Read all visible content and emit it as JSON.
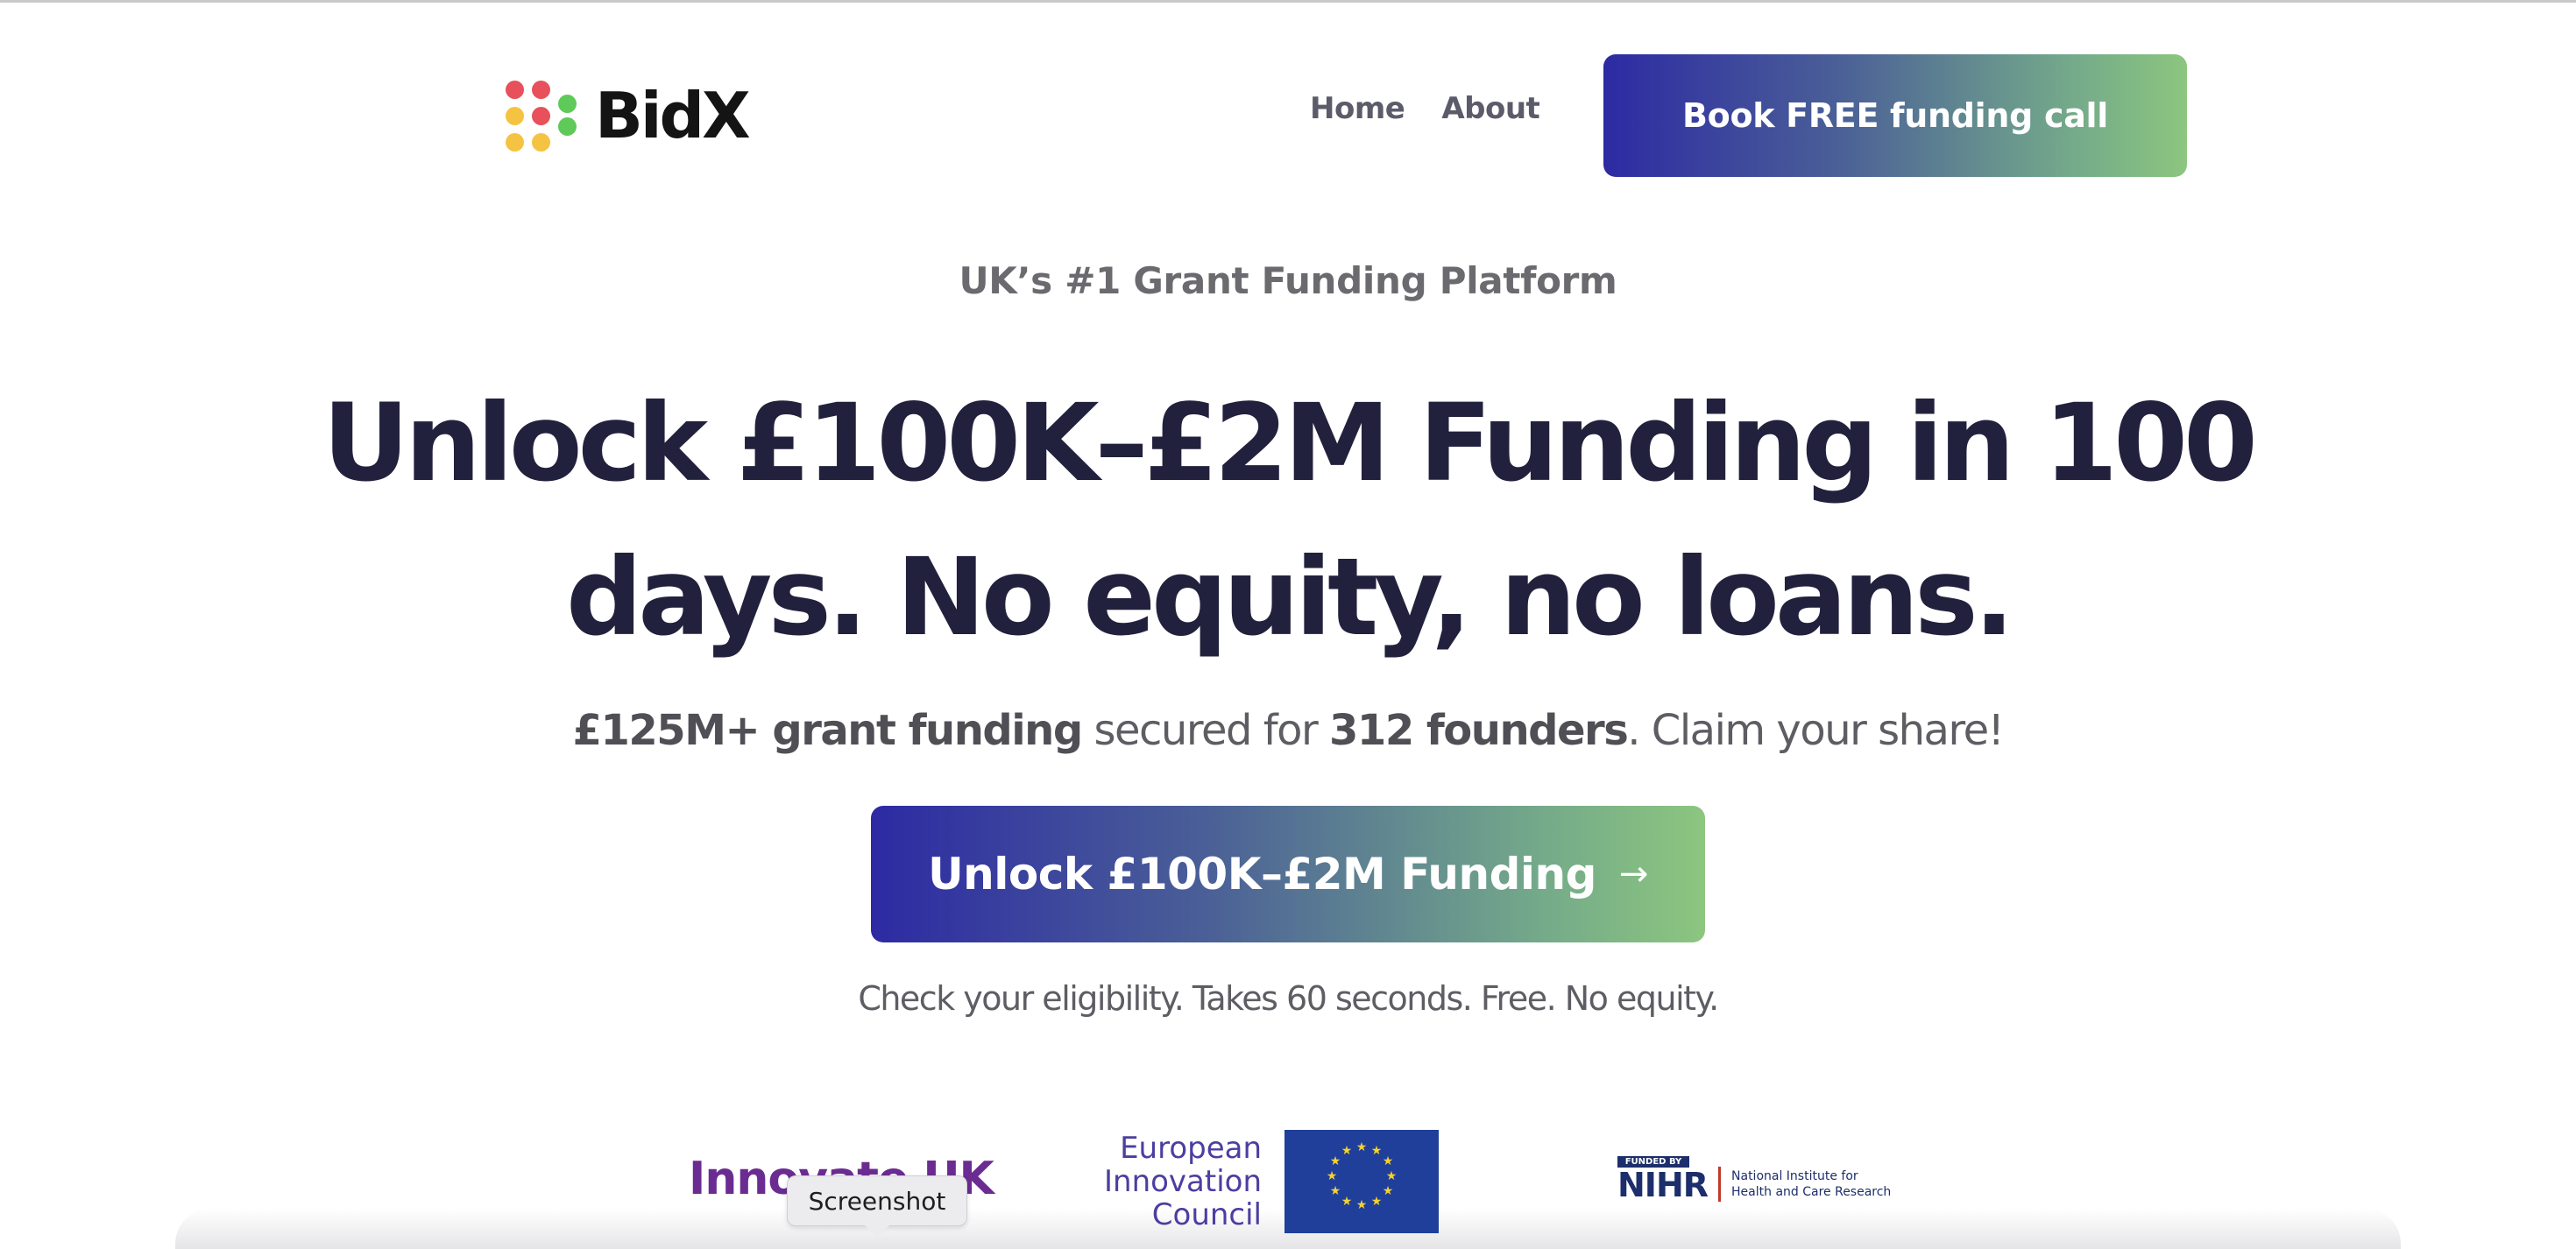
{
  "header": {
    "brand": "BidX",
    "nav": [
      {
        "label": "Home"
      },
      {
        "label": "About"
      }
    ],
    "cta_label": "Book FREE funding call"
  },
  "hero": {
    "eyebrow": "UK’s #1 Grant Funding Platform",
    "headline_line1": "Unlock £100K–£2M Funding in 100",
    "headline_line2": "days. No equity, no loans.",
    "sub_amount": "£125M+ grant funding",
    "sub_middle": " secured for ",
    "sub_founders": "312 founders",
    "sub_end": ". Claim your share!",
    "cta_label": "Unlock £100K–£2M Funding",
    "cta_arrow": "→",
    "fine_print": "Check your eligibility. Takes 60 seconds. Free. No equity."
  },
  "logos": {
    "innovate": "Innovate UK",
    "eic_line1": "European",
    "eic_line2": "Innovation",
    "eic_line3": "Council",
    "nihr_funded": "FUNDED BY",
    "nihr": "NIHR",
    "nihr_line1": "National Institute for",
    "nihr_line2": "Health and Care Research"
  },
  "tooltip": "Screenshot",
  "colors": {
    "dot_red": "#e8505b",
    "dot_yellow": "#f5c342",
    "dot_green": "#5fc95a",
    "gradient_start": "#2d2aa3",
    "gradient_end": "#8cc67f",
    "headline": "#22213d"
  },
  "icons": {
    "brand_logo": "nine-dot-grid-icon",
    "eu_flag": "eu-flag-icon",
    "cta_arrow": "arrow-right-icon"
  }
}
